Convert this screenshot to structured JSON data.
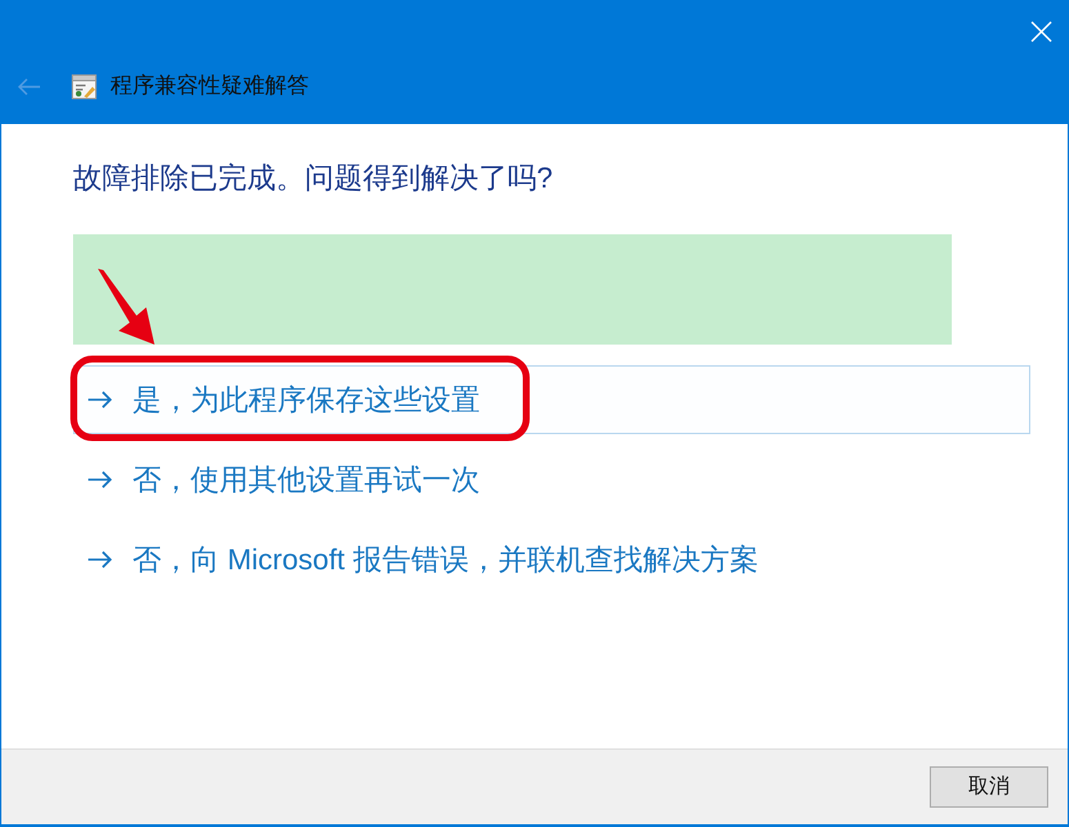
{
  "window": {
    "title": "程序兼容性疑难解答",
    "back": {
      "disabled": true
    }
  },
  "heading": "故障排除已完成。问题得到解决了吗?",
  "options": [
    {
      "label": "是，为此程序保存这些设置",
      "highlighted": true,
      "circled": true
    },
    {
      "label": "否，使用其他设置再试一次",
      "highlighted": false,
      "circled": false
    },
    {
      "label": "否，向 Microsoft 报告错误，并联机查找解决方案",
      "highlighted": false,
      "circled": false
    }
  ],
  "buttons": [
    {
      "label": "取消"
    }
  ]
}
